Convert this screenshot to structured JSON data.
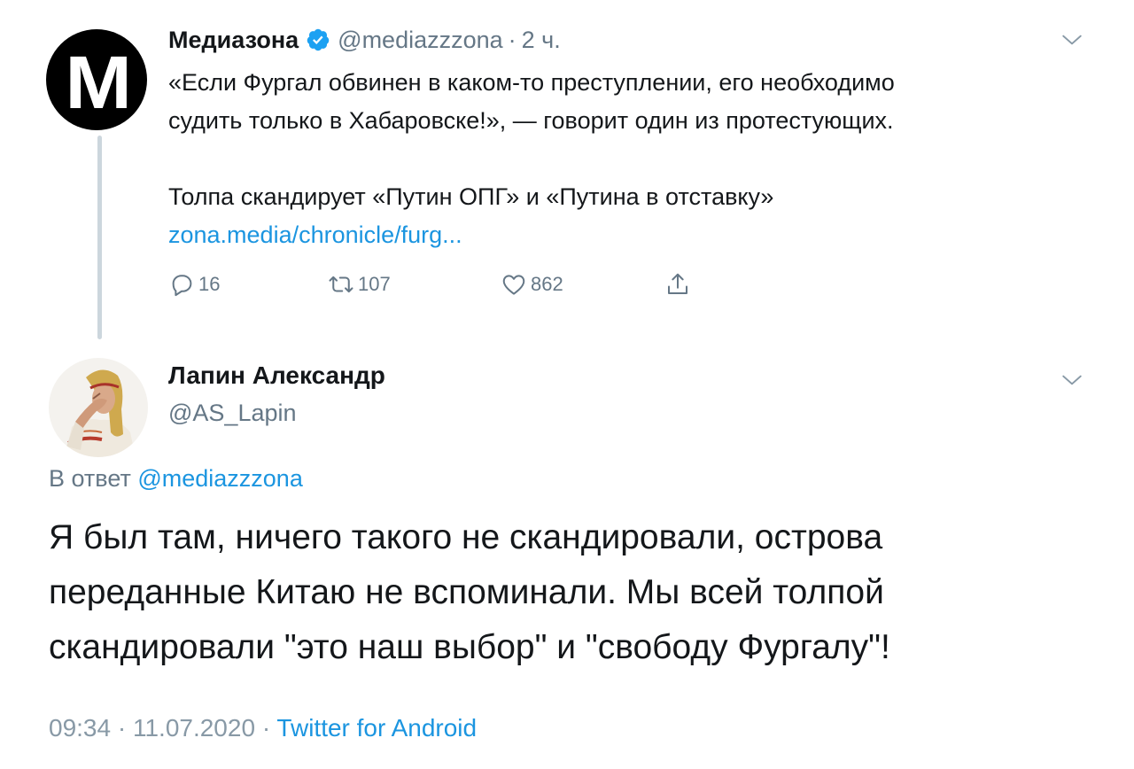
{
  "parent_tweet": {
    "avatar_letter": "M",
    "display_name": "Медиазона",
    "handle": "@mediazzzona",
    "separator": "·",
    "time": "2 ч.",
    "text_line1": "«Если Фургал обвинен в каком-то преступлении, его необходимо",
    "text_line2": "судить только в Хабаровске!», — говорит один из протестующих.",
    "text_line3": "Толпа скандирует «Путин ОПГ» и «Путина в отставку»",
    "link": "zona.media/chronicle/furg...",
    "replies": "16",
    "retweets": "107",
    "likes": "862"
  },
  "reply_tweet": {
    "display_name": "Лапин Александр",
    "handle": "@AS_Lapin",
    "in_reply_prefix": "В ответ",
    "in_reply_mention": "@mediazzzona",
    "text_line1": "Я был там, ничего такого не скандировали, острова",
    "text_line2": "переданные Китаю не вспоминали. Мы всей толпой",
    "text_line3": "скандировали \"это наш выбор\" и \"свободу Фургалу\"!",
    "time": "09:34",
    "separator1": "·",
    "date": "11.07.2020",
    "separator2": "·",
    "source": "Twitter for Android"
  },
  "icons": {
    "verified": "verified-badge-icon",
    "caret": "chevron-down-icon",
    "reply": "reply-icon",
    "retweet": "retweet-icon",
    "like": "heart-icon",
    "share": "share-icon"
  },
  "colors": {
    "link": "#1b95e0",
    "muted": "#657786",
    "thread_line": "#ccd6dd",
    "text": "#14171a"
  }
}
